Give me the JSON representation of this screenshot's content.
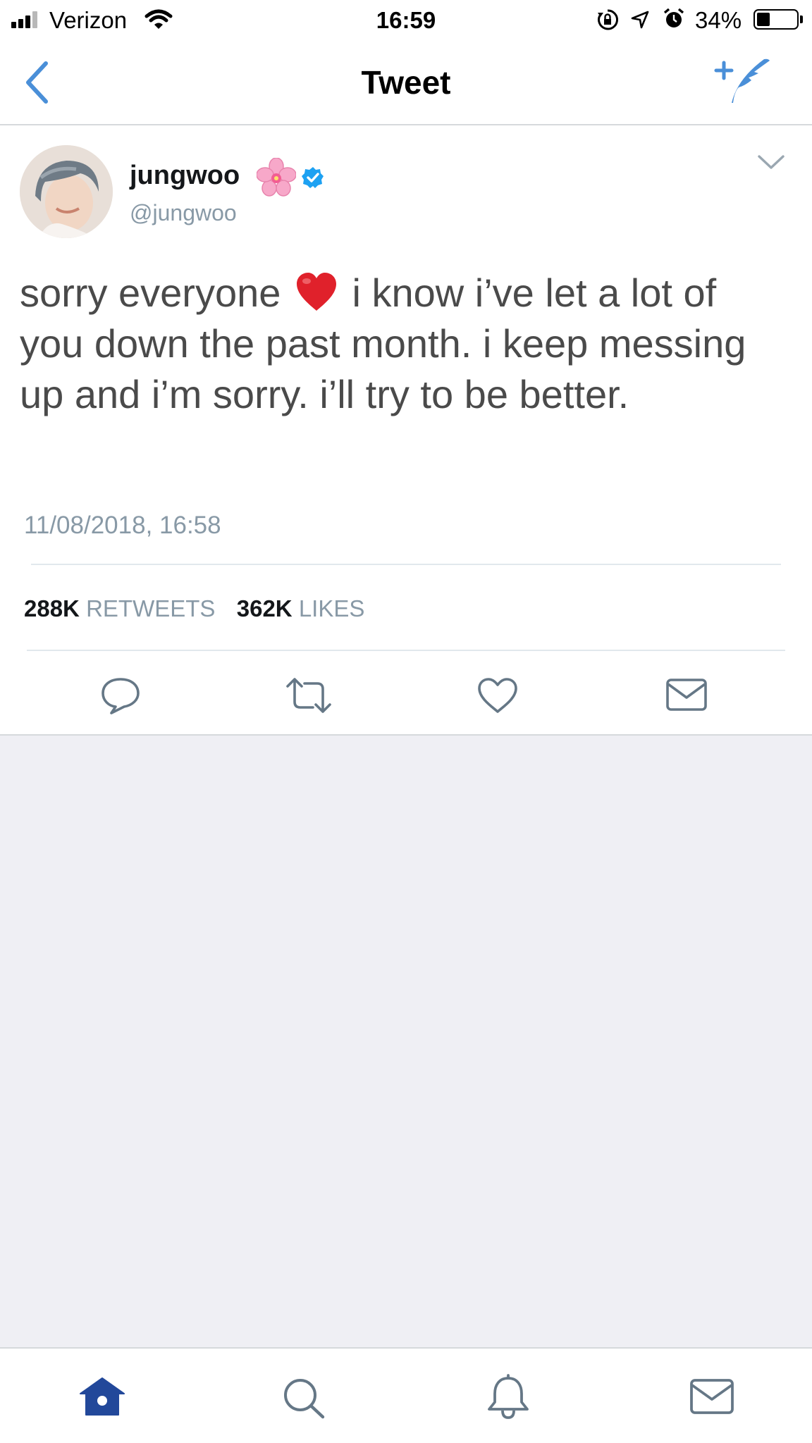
{
  "status_bar": {
    "carrier": "Verizon",
    "time": "16:59",
    "battery": "34%",
    "battery_level": 0.34
  },
  "nav": {
    "title": "Tweet",
    "back_icon": "chevron-left-icon",
    "compose_icon": "compose-quill-icon"
  },
  "tweet": {
    "display_name": "jungwoo",
    "name_emoji": "cherry-blossom",
    "verified": true,
    "handle": "@jungwoo",
    "text_before_emoji": "sorry everyone",
    "emoji": "red-heart",
    "text_line1_after": " i know i’ve let a lot of",
    "text_line2": "you down the past month. i keep messing",
    "text_line3": "up and i’m sorry. i’ll try to be better.",
    "timestamp": "11/08/2018, 16:58",
    "retweets_count": "288K",
    "retweets_label": "RETWEETS",
    "likes_count": "362K",
    "likes_label": "LIKES"
  },
  "actions": [
    "reply-icon",
    "retweet-icon",
    "like-icon",
    "direct-message-icon"
  ],
  "tabs": [
    "home-icon",
    "search-icon",
    "notifications-icon",
    "messages-icon"
  ],
  "colors": {
    "accent": "#4a8fd8",
    "tab_active": "#22489a",
    "icon_gray": "#657786",
    "secondary_text": "#8899a6",
    "divider": "#e1e8ed",
    "background_gray": "#efeff4",
    "heart": "#e0212b"
  }
}
